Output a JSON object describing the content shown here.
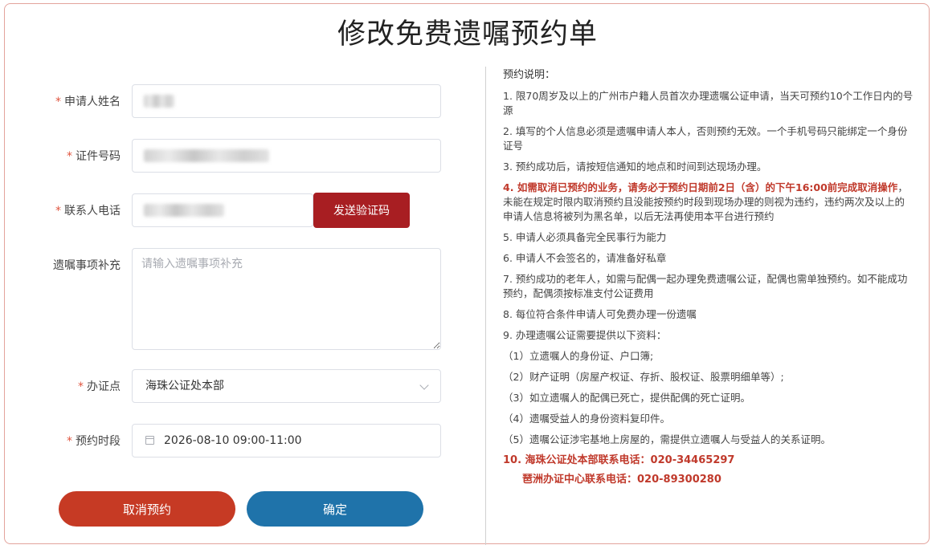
{
  "page": {
    "title": "修改免费遗嘱预约单"
  },
  "form": {
    "applicant_name": {
      "label": "申请人姓名",
      "required_mark": "*"
    },
    "id_number": {
      "label": "证件号码",
      "required_mark": "*"
    },
    "phone": {
      "label": "联系人电话",
      "required_mark": "*",
      "send_code_label": "发送验证码"
    },
    "will_notes": {
      "label": "遗嘱事项补充",
      "placeholder": "请输入遗嘱事项补充",
      "value": ""
    },
    "office": {
      "label": "办证点",
      "required_mark": "*",
      "value": "海珠公证处本部"
    },
    "time_slot": {
      "label": "预约时段",
      "required_mark": "*",
      "value": "2026-08-10 09:00-11:00"
    },
    "cancel_label": "取消预约",
    "confirm_label": "确定"
  },
  "notes": {
    "heading": "预约说明：",
    "items": [
      "1. 限70周岁及以上的广州市户籍人员首次办理遗嘱公证申请，当天可预约10个工作日内的号源",
      "2. 填写的个人信息必须是遗嘱申请人本人，否则预约无效。一个手机号码只能绑定一个身份证号",
      "3. 预约成功后，请按短信通知的地点和时间到达现场办理。"
    ],
    "item4_prefix": "4. ",
    "item4_emphasis": "如需取消已预约的业务，请务必于预约日期前2日（含）的下午16:00前完成取消操作",
    "item4_rest": "， 未能在规定时限内取消预约且没能按预约时段到现场办理的则视为违约，违约两次及以上的申请人信息将被列为黑名单，以后无法再使用本平台进行预约",
    "items_after": [
      "5. 申请人必须具备完全民事行为能力",
      "6. 申请人不会签名的，请准备好私章",
      "7. 预约成功的老年人，如需与配偶一起办理免费遗嘱公证，配偶也需单独预约。如不能成功预约，配偶须按标准支付公证费用",
      "8. 每位符合条件申请人可免费办理一份遗嘱",
      "9. 办理遗嘱公证需要提供以下资料："
    ],
    "materials": [
      "（1）立遗嘱人的身份证、户口簿;",
      "（2）财产证明（房屋产权证、存折、股权证、股票明细单等）;",
      "（3）如立遗嘱人的配偶已死亡，提供配偶的死亡证明。",
      "（4）遗嘱受益人的身份资料复印件。",
      "（5）遗嘱公证涉宅基地上房屋的，需提供立遗嘱人与受益人的关系证明。"
    ],
    "contact1": "10. 海珠公证处本部联系电话：020-34465297",
    "contact2": "琶洲办证中心联系电话：020-89300280"
  }
}
